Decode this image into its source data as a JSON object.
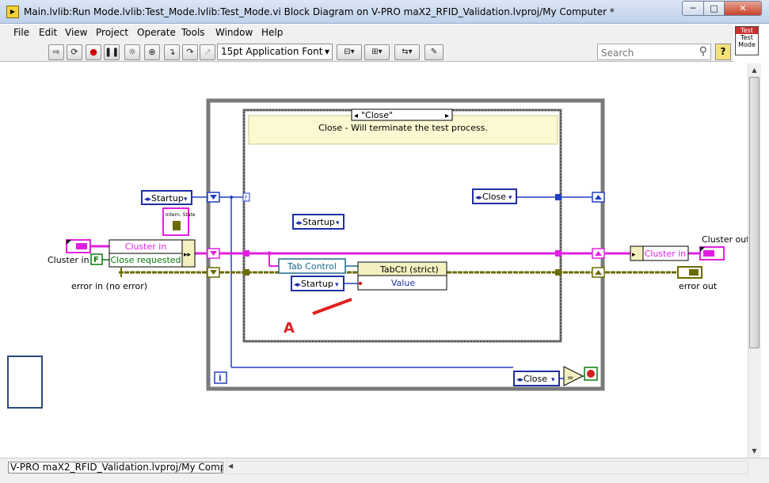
{
  "window": {
    "title": "Main.lvlib:Run Mode.lvlib:Test_Mode.lvlib:Test_Mode.vi Block Diagram on V-PRO maX2_RFID_Validation.lvproj/My Computer *",
    "min_glyph": "─",
    "max_glyph": "□",
    "close_glyph": "✕"
  },
  "menu": [
    "File",
    "Edit",
    "View",
    "Project",
    "Operate",
    "Tools",
    "Window",
    "Help"
  ],
  "toolbar": {
    "font": "15pt Application Font",
    "search_placeholder": "Search",
    "help_glyph": "?"
  },
  "vi_icon": {
    "line1": "Test",
    "line2": "Test",
    "line3": "Mode"
  },
  "diagram": {
    "case_selector": "\"Close\"",
    "case_comment": "Close - Will terminate the test process.",
    "enum_startup_outer": "Startup",
    "enum_startup_inner": "Startup",
    "enum_startup_value": "Startup",
    "enum_close_inner": "Close",
    "enum_close_bottom": "Close",
    "cluster_in_bundle": "Cluster in",
    "close_requested": "Close requested",
    "cluster_in_label": "Cluster in",
    "error_in_label": "error in (no error)",
    "tab_control": "Tab Control",
    "tabctl_property": "TabCtl (strict)",
    "value_property": "Value",
    "cluster_in_out_bundle": "Cluster in",
    "cluster_out_label": "Cluster out",
    "error_out_label": "error out",
    "annotation": "A",
    "loop_iteration": "i",
    "false_const": "F",
    "intern_state": "Intern. State",
    "equals": "="
  },
  "status": {
    "path": "V-PRO maX2_RFID_Validation.lvproj/My Computer"
  },
  "colors": {
    "enum_blue": "#1f2f9f",
    "cluster_pink": "#e020e0",
    "error_olive": "#6b6b00",
    "wire_blue": "#2040c0",
    "case_yellow": "#fbf9d2",
    "annotation_red": "#e02020"
  }
}
